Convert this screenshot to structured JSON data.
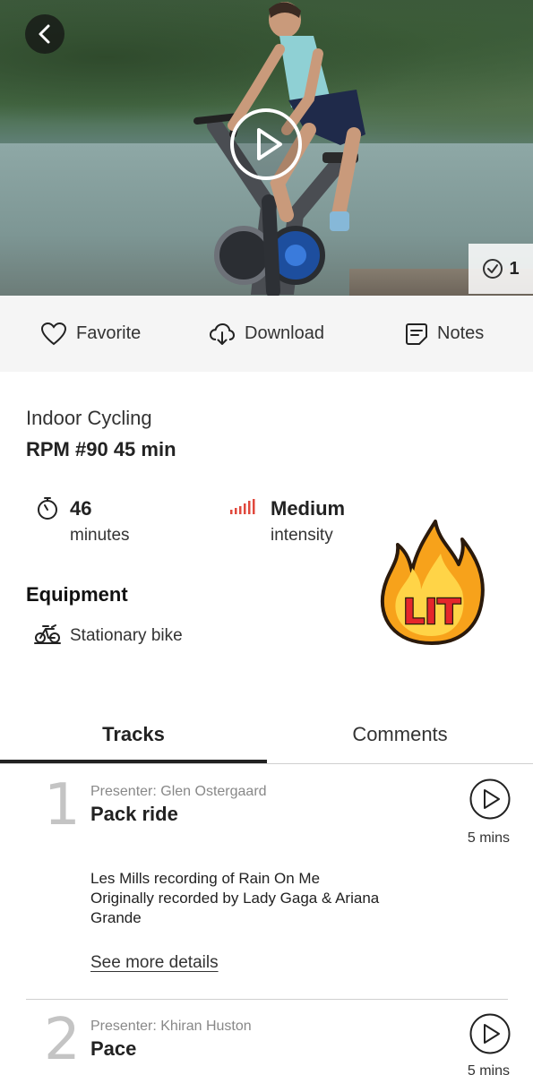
{
  "hero": {
    "completed_count": "1"
  },
  "actions": {
    "favorite": "Favorite",
    "download": "Download",
    "notes": "Notes"
  },
  "workout": {
    "category": "Indoor Cycling",
    "title": "RPM #90 45 min",
    "duration_value": "46",
    "duration_label": "minutes",
    "intensity_value": "Medium",
    "intensity_label": "intensity",
    "equipment_heading": "Equipment",
    "equipment_items": [
      "Stationary bike"
    ],
    "sticker_text": "LIT"
  },
  "tabs": [
    {
      "label": "Tracks",
      "active": true
    },
    {
      "label": "Comments",
      "active": false
    }
  ],
  "tracks": [
    {
      "number": "1",
      "presenter": "Presenter: Glen Ostergaard",
      "title": "Pack ride",
      "duration": "5 mins",
      "description": [
        "Les Mills recording of Rain On Me",
        "Originally recorded by Lady Gaga & Ariana",
        "Grande"
      ],
      "details_link": "See more details"
    },
    {
      "number": "2",
      "presenter": "Presenter: Khiran Huston",
      "title": "Pace",
      "duration": "5 mins"
    }
  ],
  "colors": {
    "intensity_bars": "#e0483c",
    "action_bar_bg": "#f5f5f5",
    "track_number": "#c4c4c4",
    "sticker_fire_outer": "#f7a21b",
    "sticker_fire_inner": "#ffd447",
    "sticker_text": "#e5262b"
  }
}
